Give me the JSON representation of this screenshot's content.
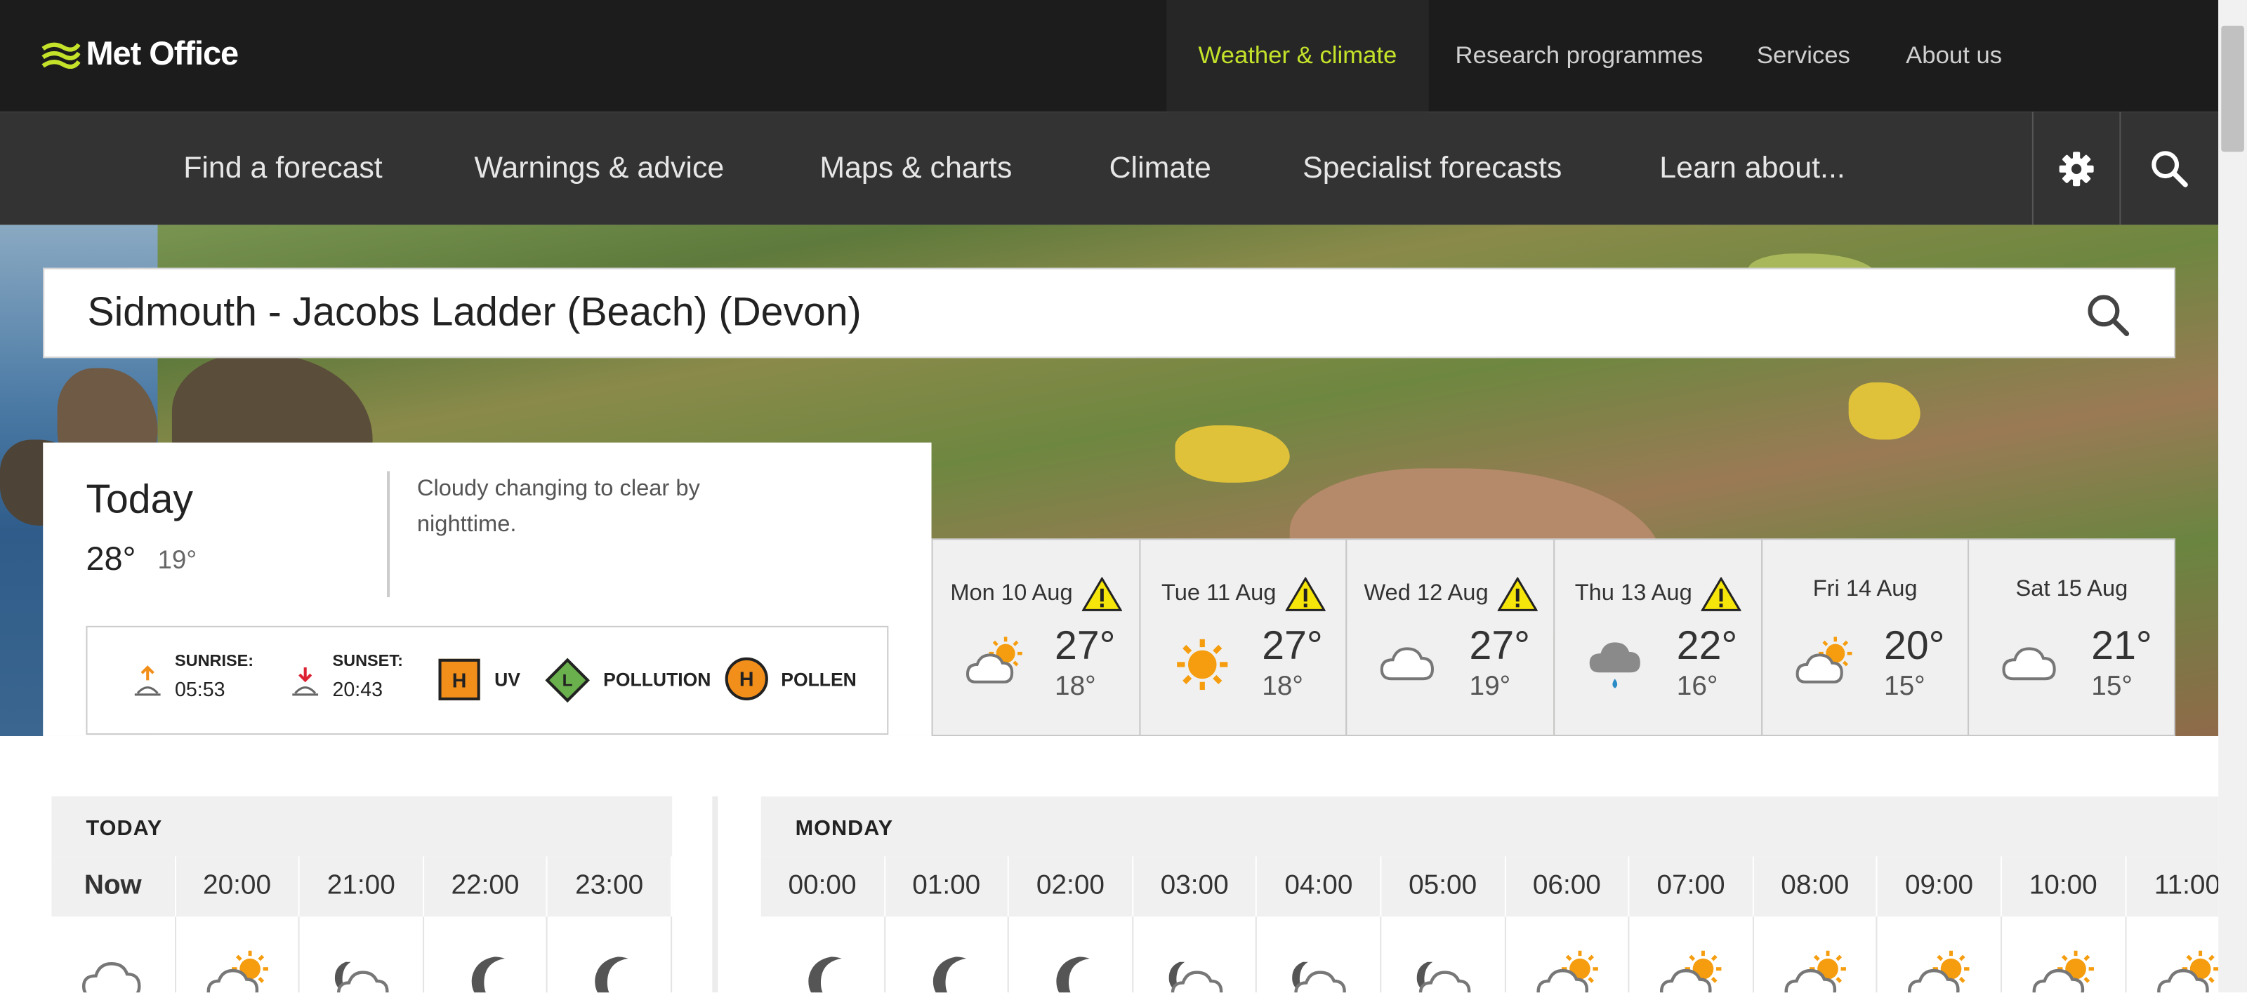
{
  "brand": {
    "name": "Met Office"
  },
  "topnav": [
    {
      "label": "Weather & climate",
      "active": true
    },
    {
      "label": "Research programmes",
      "active": false
    },
    {
      "label": "Services",
      "active": false
    },
    {
      "label": "About us",
      "active": false
    }
  ],
  "mainnav": [
    "Find a forecast",
    "Warnings & advice",
    "Maps & charts",
    "Climate",
    "Specialist forecasts",
    "Learn about..."
  ],
  "icons": {
    "settings": "gear-icon",
    "search": "search-icon"
  },
  "search": {
    "location": "Sidmouth - Jacobs Ladder (Beach) (Devon)"
  },
  "today": {
    "title": "Today",
    "high": "28°",
    "low": "19°",
    "description": "Cloudy changing to clear by nighttime.",
    "sunrise_label": "SUNRISE:",
    "sunrise": "05:53",
    "sunset_label": "SUNSET:",
    "sunset": "20:43",
    "uv_level": "H",
    "uv_label": "UV",
    "pollution_level": "L",
    "pollution_label": "POLLUTION",
    "pollen_level": "H",
    "pollen_label": "POLLEN"
  },
  "days": [
    {
      "label": "Mon 10 Aug",
      "warning": true,
      "icon": "sun-cloud-icon",
      "high": "27°",
      "low": "18°"
    },
    {
      "label": "Tue 11 Aug",
      "warning": true,
      "icon": "sun-icon",
      "high": "27°",
      "low": "18°"
    },
    {
      "label": "Wed 12 Aug",
      "warning": true,
      "icon": "cloud-icon",
      "high": "27°",
      "low": "19°"
    },
    {
      "label": "Thu 13 Aug",
      "warning": true,
      "icon": "rain-cloud-icon",
      "high": "22°",
      "low": "16°"
    },
    {
      "label": "Fri 14 Aug",
      "warning": false,
      "icon": "sun-cloud-icon",
      "high": "20°",
      "low": "15°"
    },
    {
      "label": "Sat 15 Aug",
      "warning": false,
      "icon": "cloud-icon",
      "high": "21°",
      "low": "15°"
    }
  ],
  "hourly_today": {
    "heading": "TODAY",
    "hours": [
      "Now",
      "20:00",
      "21:00",
      "22:00",
      "23:00"
    ],
    "icons": [
      "cloud-icon",
      "sun-cloud-icon",
      "moon-cloud-icon",
      "moon-icon",
      "moon-icon"
    ]
  },
  "hourly_monday": {
    "heading": "MONDAY",
    "hours": [
      "00:00",
      "01:00",
      "02:00",
      "03:00",
      "04:00",
      "05:00",
      "06:00",
      "07:00",
      "08:00",
      "09:00",
      "10:00",
      "11:00"
    ],
    "icons": [
      "moon-icon",
      "moon-icon",
      "moon-icon",
      "moon-cloud-icon",
      "moon-cloud-icon",
      "moon-cloud-icon",
      "sun-cloud-icon",
      "sun-cloud-icon",
      "sun-cloud-icon",
      "sun-cloud-icon",
      "sun-cloud-icon",
      "sun-cloud-icon"
    ]
  },
  "colors": {
    "accent": "#c5e22a",
    "topbar": "#1c1c1c",
    "mainnav": "#333333",
    "uv": "#f28f1b",
    "pollution": "#6ab04c",
    "warning": "#f5e50a"
  }
}
